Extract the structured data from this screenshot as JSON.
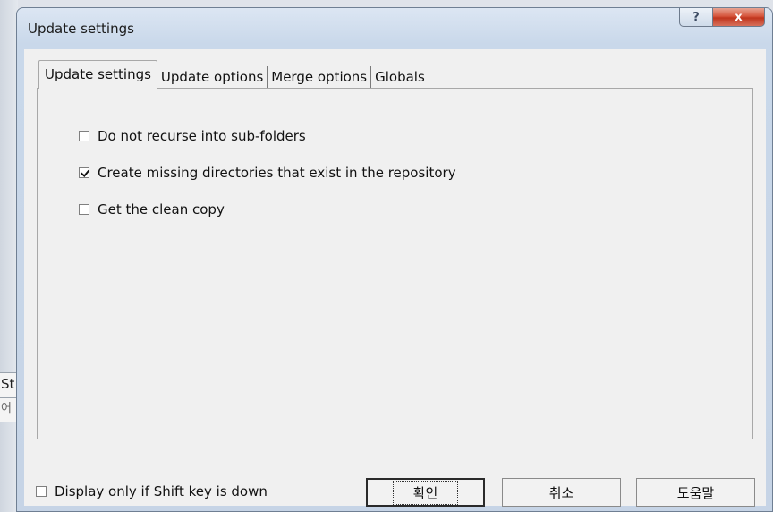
{
  "background": {
    "frag1": "St",
    "frag2": "어"
  },
  "dialog": {
    "title": "Update settings",
    "caption_help": "?",
    "caption_close": "x"
  },
  "tabs": [
    {
      "label": "Update settings",
      "active": true
    },
    {
      "label": "Update options",
      "active": false
    },
    {
      "label": "Merge options",
      "active": false
    },
    {
      "label": "Globals",
      "active": false
    }
  ],
  "options": [
    {
      "label": "Do not recurse into sub-folders",
      "checked": false
    },
    {
      "label": "Create missing directories that exist in the repository",
      "checked": true
    },
    {
      "label": "Get the clean copy",
      "checked": false
    }
  ],
  "footer": {
    "shift_checkbox": {
      "label": "Display only if Shift key is down",
      "checked": false
    },
    "ok_label": "확인",
    "cancel_label": "취소",
    "help_label": "도움말"
  },
  "colors": {
    "close_button": "#c0351d",
    "window_frame": "#c9d8ea",
    "client": "#f0f0f0"
  }
}
